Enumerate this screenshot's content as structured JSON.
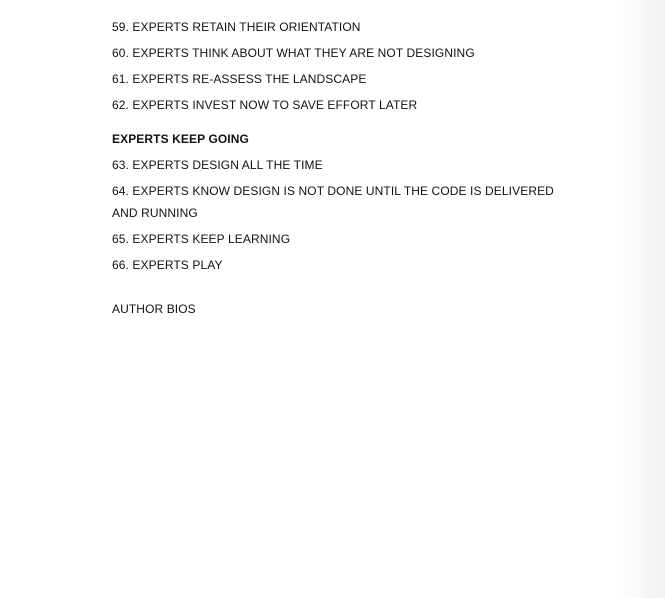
{
  "toc": {
    "items_a": [
      "59. EXPERTS RETAIN THEIR ORIENTATION",
      "60. EXPERTS THINK ABOUT WHAT THEY ARE NOT DESIGNING",
      "61. EXPERTS RE-ASSESS THE LANDSCAPE",
      "62. EXPERTS INVEST NOW TO SAVE EFFORT LATER"
    ],
    "section_heading": "EXPERTS KEEP GOING",
    "items_b": [
      "63. EXPERTS DESIGN ALL THE TIME",
      "64. EXPERTS KNOW DESIGN IS NOT DONE UNTIL THE CODE IS DELIVERED AND RUNNING",
      "65. EXPERTS KEEP LEARNING",
      "66. EXPERTS PLAY"
    ],
    "author_bios": "AUTHOR BIOS"
  }
}
